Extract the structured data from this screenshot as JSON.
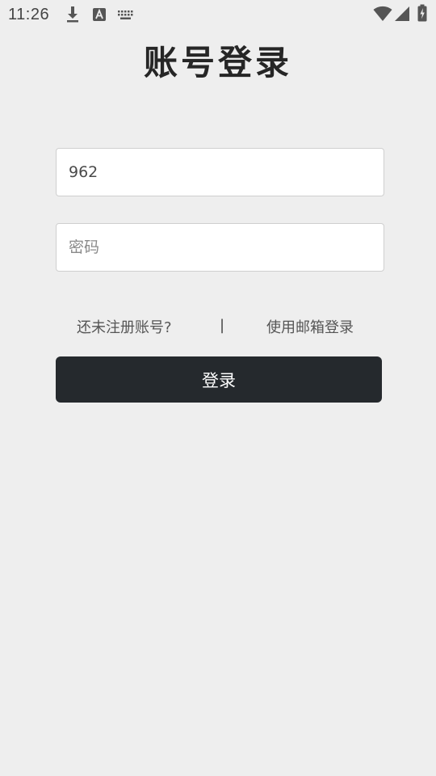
{
  "status_bar": {
    "time": "11:26",
    "icons": [
      "download-icon",
      "text-a-icon",
      "keyboard-icon",
      "wifi-icon",
      "cellular-signal-icon",
      "battery-charging-icon"
    ]
  },
  "page": {
    "title": "账号登录"
  },
  "form": {
    "username_value": "962",
    "password_placeholder": "密码",
    "password_value": ""
  },
  "links": {
    "register_label": "还未注册账号?",
    "divider": "|",
    "email_login_label": "使用邮箱登录"
  },
  "actions": {
    "login_label": "登录"
  },
  "colors": {
    "background": "#eeeeee",
    "button_bg": "#25292d",
    "button_text": "#ffffff",
    "input_border": "#cfcfcf"
  }
}
